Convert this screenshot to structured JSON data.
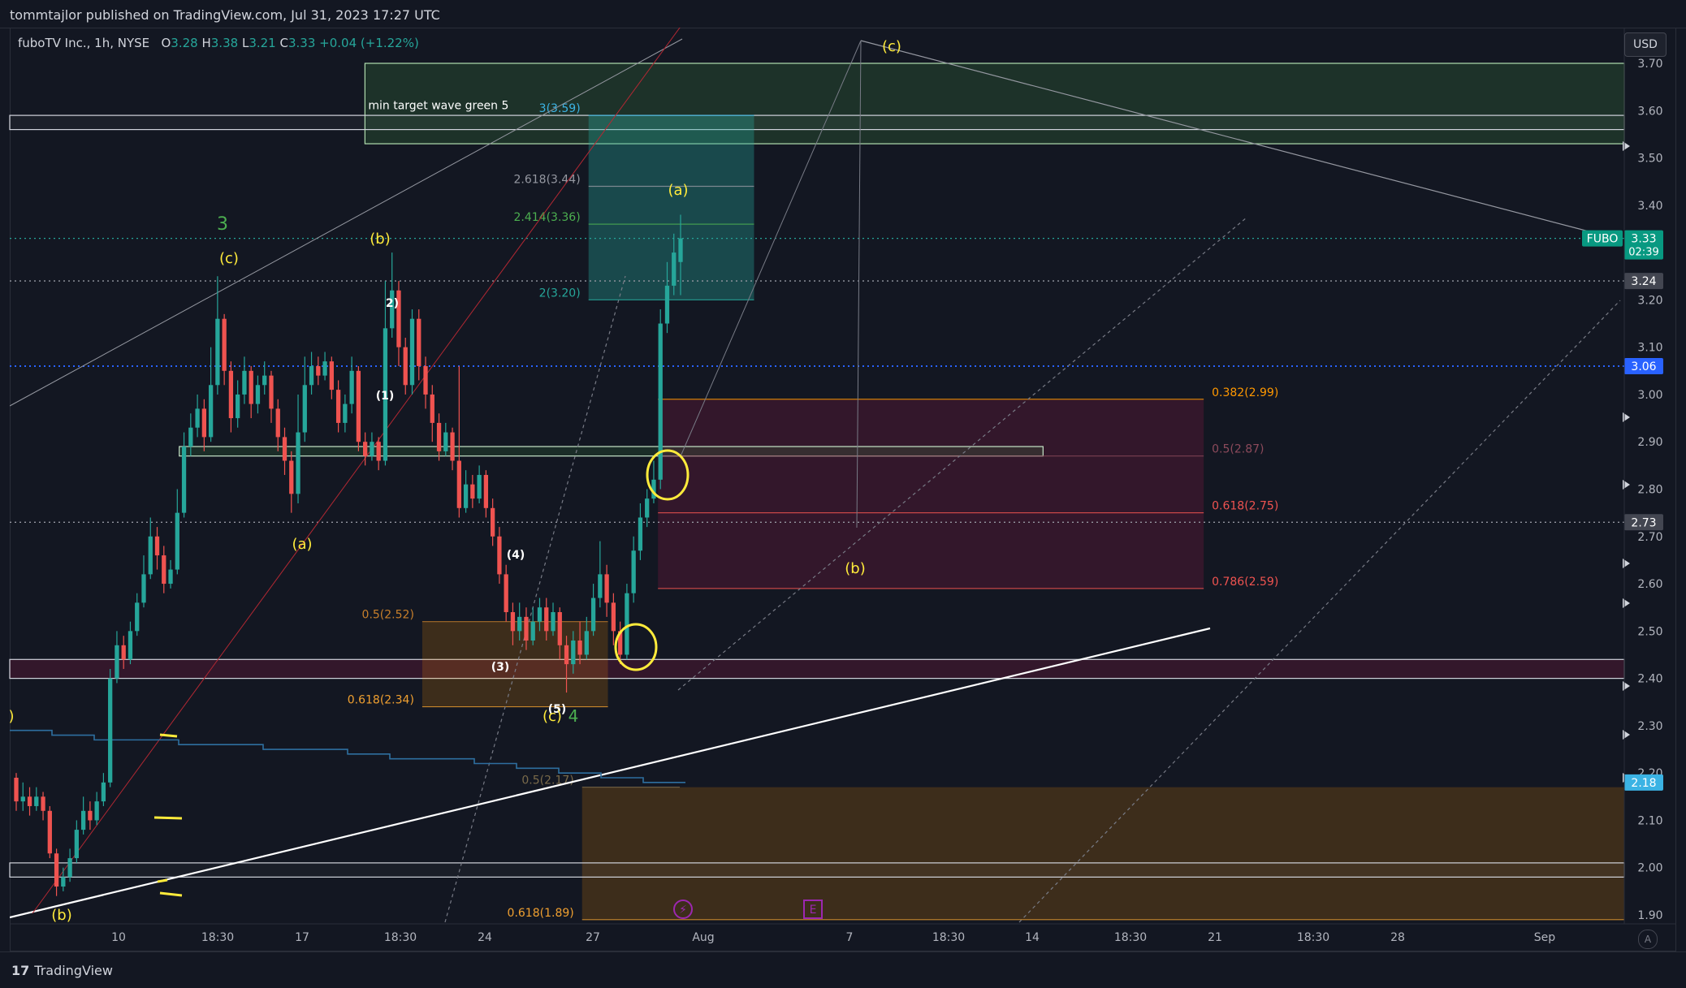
{
  "header": {
    "published_line": "tommtajlor published on TradingView.com, Jul 31, 2023 17:27 UTC"
  },
  "legend": {
    "symbol": "fuboTV Inc., 1h, NYSE",
    "o_label": "O",
    "o": "3.28",
    "h_label": "H",
    "h": "3.38",
    "l_label": "L",
    "l": "3.21",
    "c_label": "C",
    "c": "3.33",
    "change": "+0.04 (+1.22%)"
  },
  "currency_button": "USD",
  "scale_mode_button": "A",
  "footer": {
    "brand": "TradingView",
    "brand_mark": "17"
  },
  "colors": {
    "up": "#26a69a",
    "down": "#ef5350",
    "background": "#131722",
    "wave_yellow": "#ffeb3b",
    "wave_green": "#4caf50"
  },
  "chart_data": {
    "type": "candlestick",
    "ylim": [
      1.87,
      3.73
    ],
    "x_ticks": [
      "10",
      "18:30",
      "17",
      "18:30",
      "24",
      "27",
      "Aug",
      "7",
      "18:30",
      "14",
      "18:30",
      "21",
      "18:30",
      "28",
      "Sep"
    ],
    "y_ticks": [
      "3.70",
      "3.60",
      "3.50",
      "3.40",
      "3.20",
      "3.10",
      "3.00",
      "2.90",
      "2.80",
      "2.70",
      "2.60",
      "2.50",
      "2.40",
      "2.30",
      "2.20",
      "2.10",
      "2.00",
      "1.90"
    ],
    "price_badges": [
      {
        "label": "FUBO",
        "value": "3.33",
        "sub": "02:39",
        "y": 3.33,
        "color": "#089981"
      },
      {
        "value": "3.24",
        "y": 3.24,
        "color": "#434651"
      },
      {
        "value": "3.06",
        "y": 3.06,
        "color": "#2962ff"
      },
      {
        "value": "2.73",
        "y": 2.73,
        "color": "#434651"
      },
      {
        "value": "2.18",
        "y": 2.18,
        "color": "#3bb3e4"
      }
    ],
    "horizontal_lines": [
      {
        "y": 3.33,
        "style": "dotted",
        "color": "#26a69a"
      },
      {
        "y": 3.24,
        "style": "dotted",
        "color": "#9598a1"
      },
      {
        "y": 3.06,
        "style": "dotted",
        "color": "#2962ff"
      },
      {
        "y": 2.73,
        "style": "dotted",
        "color": "#9598a1"
      }
    ],
    "zones": [
      {
        "name": "target-zone",
        "y1": 3.53,
        "y2": 3.7,
        "x1": 0.22,
        "x2": 1.0,
        "fill": "rgba(76,175,80,0.18)",
        "stroke": "#b2dfb0",
        "label": "min target wave green 5"
      },
      {
        "name": "resistance-band",
        "y1": 3.56,
        "y2": 3.59,
        "x1": 0.0,
        "x2": 1.0,
        "fill": "rgba(255,255,255,0.04)",
        "stroke": "#d1d4dc"
      },
      {
        "name": "fib-extension-box",
        "y1": 3.2,
        "y2": 3.59,
        "x1": 0.3585,
        "x2": 0.461,
        "fill": "rgba(38,166,154,0.35)",
        "stroke": "none"
      },
      {
        "name": "retracement-box",
        "y1": 2.59,
        "y2": 2.99,
        "x1": 0.4015,
        "x2": 0.7395,
        "fill": "rgba(233,30,99,0.15)",
        "stroke": "none"
      },
      {
        "name": "support-band",
        "y1": 2.4,
        "y2": 2.44,
        "x1": 0.0,
        "x2": 1.0,
        "fill": "rgba(233,30,99,0.15)",
        "stroke": "#d1d4dc"
      },
      {
        "name": "mid-band",
        "y1": 2.87,
        "y2": 2.89,
        "x1": 0.105,
        "x2": 0.64,
        "fill": "rgba(76,175,80,0.15)",
        "stroke": "#c8e6c9"
      },
      {
        "name": "wave4-box",
        "y1": 2.34,
        "y2": 2.52,
        "x1": 0.2555,
        "x2": 0.3705,
        "fill": "rgba(255,152,0,0.18)",
        "stroke": "none"
      },
      {
        "name": "deep-box",
        "y1": 1.89,
        "y2": 2.17,
        "x1": 0.3545,
        "x2": 1.0,
        "fill": "rgba(255,152,0,0.18)",
        "stroke": "none"
      },
      {
        "name": "bottom-band",
        "y1": 1.98,
        "y2": 2.01,
        "x1": 0.0,
        "x2": 1.0,
        "fill": "rgba(255,255,255,0.03)",
        "stroke": "#d1d4dc"
      }
    ],
    "fib_levels": [
      {
        "label": "3(3.59)",
        "y": 3.59,
        "color": "#3bb3e4"
      },
      {
        "label": "2.618(3.44)",
        "y": 3.44,
        "color": "#9598a1"
      },
      {
        "label": "2.414(3.36)",
        "y": 3.36,
        "color": "#4caf50"
      },
      {
        "label": "2(3.20)",
        "y": 3.2,
        "color": "#26a69a"
      },
      {
        "label": "0.382(2.99)",
        "y": 2.99,
        "color": "#ff9800"
      },
      {
        "label": "0.5(2.87)",
        "y": 2.87,
        "color": "#8c4a5b"
      },
      {
        "label": "0.618(2.75)",
        "y": 2.75,
        "color": "#ef5350"
      },
      {
        "label": "0.786(2.59)",
        "y": 2.59,
        "color": "#ef5350"
      },
      {
        "label": "0.5(2.52)",
        "y": 2.52,
        "color": "#c77f2b"
      },
      {
        "label": "0.618(2.34)",
        "y": 2.34,
        "color": "#f0a030"
      },
      {
        "label": "0.5(2.17)",
        "y": 2.17,
        "color": "#7a6a4a"
      },
      {
        "label": "0.618(1.89)",
        "y": 1.89,
        "color": "#f0a030"
      }
    ],
    "wave_labels": [
      {
        "text": "3",
        "color": "#4caf50"
      },
      {
        "text": "(c)",
        "color": "#ffeb3b"
      },
      {
        "text": "(b)",
        "color": "#ffeb3b"
      },
      {
        "text": "(a)",
        "color": "#ffeb3b"
      },
      {
        "text": "2)",
        "color": "#ffffff"
      },
      {
        "text": "(1)",
        "color": "#ffffff"
      },
      {
        "text": "(4)",
        "color": "#ffffff"
      },
      {
        "text": "(3)",
        "color": "#ffffff"
      },
      {
        "text": "(5)",
        "color": "#ffffff"
      },
      {
        "text": "(c)",
        "color": "#ffeb3b"
      },
      {
        "text": "4",
        "color": "#4caf50"
      },
      {
        "text": "(a)",
        "color": "#ffeb3b"
      },
      {
        "text": "(c)",
        "color": "#ffeb3b"
      },
      {
        "text": "(b)",
        "color": "#ffeb3b"
      },
      {
        "text": "(b)",
        "color": "#ffeb3b"
      },
      {
        "text": ")",
        "color": "#ffeb3b"
      }
    ],
    "event_markers": [
      {
        "name": "lightning-icon",
        "symbol": "⚡",
        "color": "#9c27b0"
      },
      {
        "name": "earnings-icon",
        "symbol": "E",
        "color": "#9c27b0"
      }
    ],
    "candles": [
      [
        2.19,
        2.14,
        2.2,
        2.12
      ],
      [
        2.14,
        2.15,
        2.18,
        2.12
      ],
      [
        2.15,
        2.13,
        2.17,
        2.11
      ],
      [
        2.13,
        2.15,
        2.17,
        2.12
      ],
      [
        2.15,
        2.12,
        2.16,
        2.1
      ],
      [
        2.12,
        2.03,
        2.13,
        2.02
      ],
      [
        2.03,
        1.96,
        2.04,
        1.94
      ],
      [
        1.96,
        1.98,
        2.0,
        1.95
      ],
      [
        1.98,
        2.02,
        2.04,
        1.97
      ],
      [
        2.02,
        2.08,
        2.1,
        2.01
      ],
      [
        2.08,
        2.12,
        2.15,
        2.07
      ],
      [
        2.12,
        2.1,
        2.14,
        2.08
      ],
      [
        2.1,
        2.14,
        2.16,
        2.09
      ],
      [
        2.14,
        2.18,
        2.2,
        2.13
      ],
      [
        2.18,
        2.4,
        2.42,
        2.17
      ],
      [
        2.4,
        2.47,
        2.5,
        2.39
      ],
      [
        2.47,
        2.44,
        2.49,
        2.42
      ],
      [
        2.44,
        2.5,
        2.52,
        2.43
      ],
      [
        2.5,
        2.56,
        2.58,
        2.49
      ],
      [
        2.56,
        2.62,
        2.66,
        2.55
      ],
      [
        2.62,
        2.7,
        2.74,
        2.61
      ],
      [
        2.7,
        2.66,
        2.72,
        2.63
      ],
      [
        2.66,
        2.6,
        2.68,
        2.58
      ],
      [
        2.6,
        2.63,
        2.65,
        2.59
      ],
      [
        2.63,
        2.75,
        2.8,
        2.62
      ],
      [
        2.75,
        2.89,
        2.92,
        2.74
      ],
      [
        2.89,
        2.93,
        2.96,
        2.87
      ],
      [
        2.93,
        2.97,
        3.0,
        2.91
      ],
      [
        2.97,
        2.91,
        2.99,
        2.88
      ],
      [
        2.91,
        3.02,
        3.1,
        2.9
      ],
      [
        3.02,
        3.16,
        3.25,
        3.0
      ],
      [
        3.16,
        3.05,
        3.17,
        3.02
      ],
      [
        3.05,
        2.95,
        3.07,
        2.92
      ],
      [
        2.95,
        3.0,
        3.03,
        2.93
      ],
      [
        3.0,
        3.05,
        3.08,
        2.98
      ],
      [
        3.05,
        2.98,
        3.06,
        2.95
      ],
      [
        2.98,
        3.02,
        3.04,
        2.96
      ],
      [
        3.02,
        3.04,
        3.07,
        3.0
      ],
      [
        3.04,
        2.97,
        3.05,
        2.94
      ],
      [
        2.97,
        2.91,
        2.99,
        2.88
      ],
      [
        2.91,
        2.86,
        2.93,
        2.83
      ],
      [
        2.86,
        2.79,
        2.88,
        2.75
      ],
      [
        2.79,
        2.92,
        3.0,
        2.77
      ],
      [
        2.92,
        3.02,
        3.08,
        2.9
      ],
      [
        3.02,
        3.06,
        3.09,
        3.0
      ],
      [
        3.06,
        3.04,
        3.08,
        3.02
      ],
      [
        3.04,
        3.07,
        3.09,
        3.03
      ],
      [
        3.07,
        3.01,
        3.08,
        2.99
      ],
      [
        3.01,
        2.94,
        3.03,
        2.92
      ],
      [
        2.94,
        2.98,
        3.0,
        2.92
      ],
      [
        2.98,
        3.05,
        3.08,
        2.96
      ],
      [
        3.05,
        2.9,
        3.06,
        2.88
      ],
      [
        2.9,
        2.87,
        2.92,
        2.85
      ],
      [
        2.87,
        2.9,
        2.92,
        2.86
      ],
      [
        2.9,
        2.86,
        2.91,
        2.84
      ],
      [
        2.86,
        3.14,
        3.24,
        2.85
      ],
      [
        3.14,
        3.22,
        3.3,
        3.12
      ],
      [
        3.22,
        3.1,
        3.24,
        3.06
      ],
      [
        3.1,
        3.02,
        3.12,
        3.0
      ],
      [
        3.02,
        3.16,
        3.18,
        3.0
      ],
      [
        3.16,
        3.06,
        3.18,
        3.03
      ],
      [
        3.06,
        3.0,
        3.08,
        2.97
      ],
      [
        3.0,
        2.94,
        3.02,
        2.9
      ],
      [
        2.94,
        2.88,
        2.96,
        2.86
      ],
      [
        2.88,
        2.92,
        2.94,
        2.87
      ],
      [
        2.92,
        2.86,
        2.93,
        2.84
      ],
      [
        2.86,
        2.76,
        3.06,
        2.74
      ],
      [
        2.76,
        2.81,
        2.84,
        2.75
      ],
      [
        2.81,
        2.78,
        2.83,
        2.76
      ],
      [
        2.78,
        2.83,
        2.85,
        2.77
      ],
      [
        2.83,
        2.76,
        2.84,
        2.74
      ],
      [
        2.76,
        2.7,
        2.78,
        2.68
      ],
      [
        2.7,
        2.62,
        2.72,
        2.6
      ],
      [
        2.62,
        2.54,
        2.64,
        2.52
      ],
      [
        2.54,
        2.5,
        2.56,
        2.47
      ],
      [
        2.5,
        2.53,
        2.56,
        2.48
      ],
      [
        2.53,
        2.48,
        2.55,
        2.46
      ],
      [
        2.48,
        2.52,
        2.55,
        2.47
      ],
      [
        2.52,
        2.55,
        2.57,
        2.5
      ],
      [
        2.55,
        2.5,
        2.57,
        2.48
      ],
      [
        2.5,
        2.54,
        2.56,
        2.49
      ],
      [
        2.54,
        2.47,
        2.55,
        2.44
      ],
      [
        2.47,
        2.43,
        2.49,
        2.37
      ],
      [
        2.43,
        2.48,
        2.5,
        2.41
      ],
      [
        2.48,
        2.45,
        2.52,
        2.43
      ],
      [
        2.45,
        2.5,
        2.53,
        2.44
      ],
      [
        2.5,
        2.57,
        2.6,
        2.49
      ],
      [
        2.57,
        2.62,
        2.69,
        2.55
      ],
      [
        2.62,
        2.56,
        2.64,
        2.53
      ],
      [
        2.56,
        2.5,
        2.58,
        2.47
      ],
      [
        2.5,
        2.45,
        2.52,
        2.43
      ],
      [
        2.45,
        2.58,
        2.6,
        2.44
      ],
      [
        2.58,
        2.67,
        2.7,
        2.56
      ],
      [
        2.67,
        2.74,
        2.77,
        2.65
      ],
      [
        2.74,
        2.78,
        2.8,
        2.72
      ],
      [
        2.78,
        2.82,
        2.86,
        2.77
      ],
      [
        2.82,
        3.15,
        3.18,
        2.8
      ],
      [
        3.15,
        3.23,
        3.28,
        3.13
      ],
      [
        3.23,
        3.3,
        3.34,
        3.21
      ],
      [
        3.28,
        3.33,
        3.38,
        3.21
      ]
    ]
  }
}
